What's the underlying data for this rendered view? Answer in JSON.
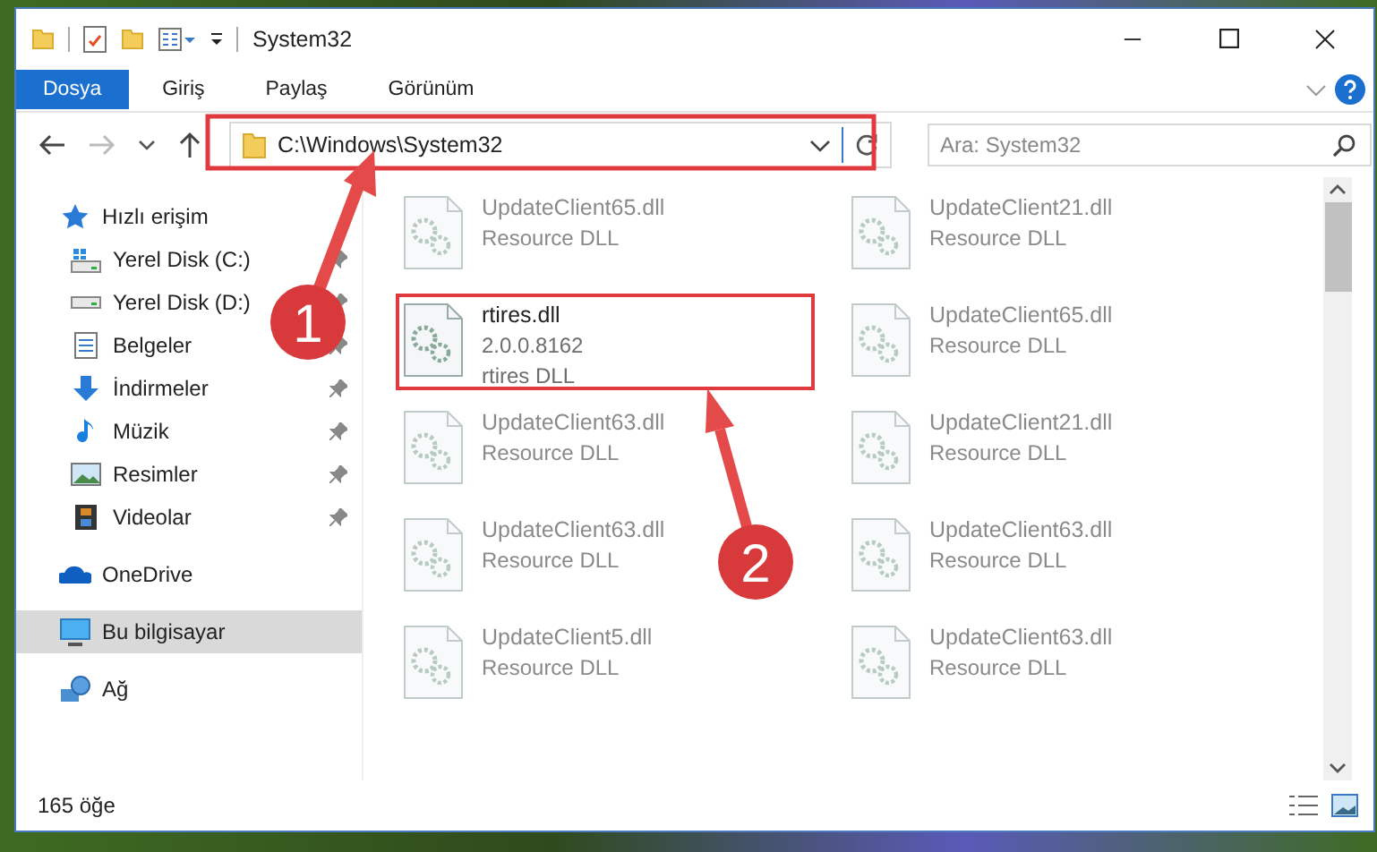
{
  "window": {
    "title": "System32"
  },
  "ribbon_tabs": [
    {
      "label": "Dosya",
      "selected": true
    },
    {
      "label": "Giriş",
      "selected": false
    },
    {
      "label": "Paylaş",
      "selected": false
    },
    {
      "label": "Görünüm",
      "selected": false
    }
  ],
  "address_bar": {
    "path": "C:\\Windows\\System32"
  },
  "search": {
    "placeholder": "Ara: System32"
  },
  "sidebar": {
    "items": [
      {
        "label": "Hızlı erişim",
        "kind": "star",
        "selected": false,
        "children": [
          {
            "label": "Yerel Disk (C:)",
            "kind": "system-drive",
            "pinned": true,
            "selected": false
          },
          {
            "label": "Yerel Disk (D:)",
            "kind": "drive",
            "pinned": true,
            "selected": false
          },
          {
            "label": "Belgeler",
            "kind": "documents",
            "pinned": true,
            "selected": false
          },
          {
            "label": "İndirmeler",
            "kind": "downloads",
            "pinned": true,
            "selected": false
          },
          {
            "label": "Müzik",
            "kind": "music",
            "pinned": true,
            "selected": false
          },
          {
            "label": "Resimler",
            "kind": "pictures",
            "pinned": true,
            "selected": false
          },
          {
            "label": "Videolar",
            "kind": "videos",
            "pinned": true,
            "selected": false
          }
        ]
      },
      {
        "label": "OneDrive",
        "kind": "cloud",
        "selected": false
      },
      {
        "label": "Bu bilgisayar",
        "kind": "computer",
        "selected": true
      },
      {
        "label": "Ağ",
        "kind": "network",
        "selected": false
      }
    ]
  },
  "files": [
    {
      "name": "UpdateClient65.dll",
      "details": [
        "Resource DLL"
      ],
      "blurred": true,
      "highlighted": false
    },
    {
      "name": "UpdateClient21.dll",
      "details": [
        "Resource DLL"
      ],
      "blurred": true,
      "highlighted": false
    },
    {
      "name": "rtires.dll",
      "details": [
        "2.0.0.8162",
        "rtires DLL"
      ],
      "blurred": false,
      "highlighted": true
    },
    {
      "name": "UpdateClient65.dll",
      "details": [
        "Resource DLL"
      ],
      "blurred": true,
      "highlighted": false
    },
    {
      "name": "UpdateClient63.dll",
      "details": [
        "Resource DLL"
      ],
      "blurred": true,
      "highlighted": false
    },
    {
      "name": "UpdateClient21.dll",
      "details": [
        "Resource DLL"
      ],
      "blurred": true,
      "highlighted": false
    },
    {
      "name": "UpdateClient63.dll",
      "details": [
        "Resource DLL"
      ],
      "blurred": true,
      "highlighted": false
    },
    {
      "name": "UpdateClient63.dll",
      "details": [
        "Resource DLL"
      ],
      "blurred": true,
      "highlighted": false
    },
    {
      "name": "UpdateClient5.dll",
      "details": [
        "Resource DLL"
      ],
      "blurred": true,
      "highlighted": false
    },
    {
      "name": "UpdateClient63.dll",
      "details": [
        "Resource DLL"
      ],
      "blurred": true,
      "highlighted": false
    }
  ],
  "status_bar": {
    "item_count": "165 öğe"
  },
  "annotations": [
    {
      "number": "1"
    },
    {
      "number": "2"
    }
  ]
}
